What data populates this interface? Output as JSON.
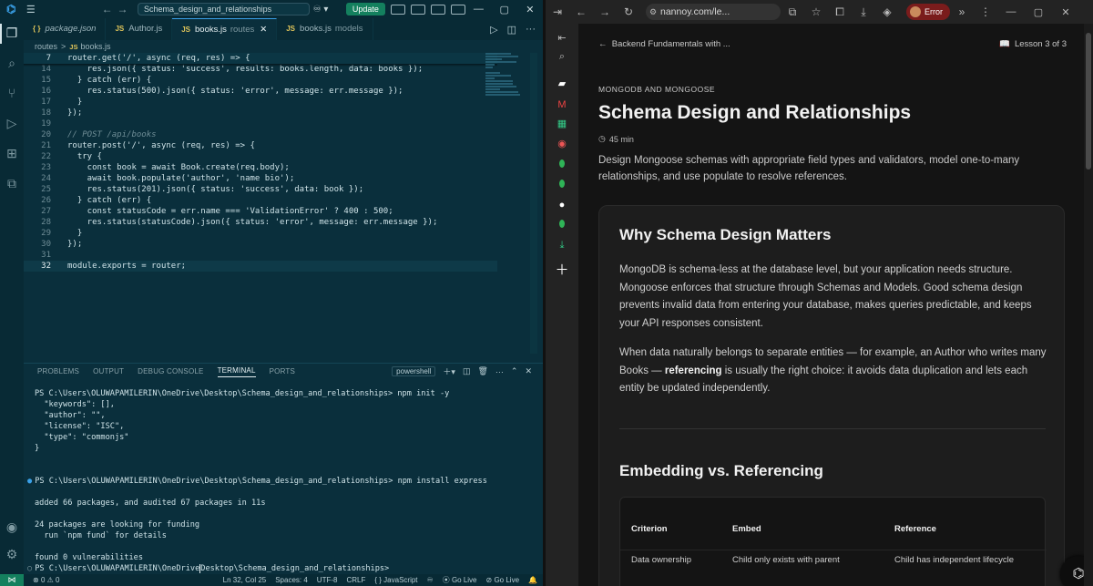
{
  "vscode": {
    "command_center": "Schema_design_and_relationships",
    "update_button": "Update",
    "tabs": [
      {
        "icon": "{ }",
        "label": "package.json",
        "sub": ""
      },
      {
        "icon": "JS",
        "label": "Author.js",
        "sub": ""
      },
      {
        "icon": "JS",
        "label": "books.js",
        "sub": "routes"
      },
      {
        "icon": "JS",
        "label": "books.js",
        "sub": "models"
      }
    ],
    "breadcrumb": {
      "folder": "routes",
      "sep": ">",
      "file_icon": "JS",
      "file": "books.js"
    },
    "code_lines": [
      {
        "num": "7",
        "text": "router.get('/', async (req, res) => {"
      },
      {
        "num": "14",
        "text": "    res.json({ status: 'success', results: books.length, data: books });"
      },
      {
        "num": "15",
        "text": "  } catch (err) {"
      },
      {
        "num": "16",
        "text": "    res.status(500).json({ status: 'error', message: err.message });"
      },
      {
        "num": "17",
        "text": "  }"
      },
      {
        "num": "18",
        "text": "});"
      },
      {
        "num": "19",
        "text": ""
      },
      {
        "num": "20",
        "text": "// POST /api/books"
      },
      {
        "num": "21",
        "text": "router.post('/', async (req, res) => {"
      },
      {
        "num": "22",
        "text": "  try {"
      },
      {
        "num": "23",
        "text": "    const book = await Book.create(req.body);"
      },
      {
        "num": "24",
        "text": "    await book.populate('author', 'name bio');"
      },
      {
        "num": "25",
        "text": "    res.status(201).json({ status: 'success', data: book });"
      },
      {
        "num": "26",
        "text": "  } catch (err) {"
      },
      {
        "num": "27",
        "text": "    const statusCode = err.name === 'ValidationError' ? 400 : 500;"
      },
      {
        "num": "28",
        "text": "    res.status(statusCode).json({ status: 'error', message: err.message });"
      },
      {
        "num": "29",
        "text": "  }"
      },
      {
        "num": "30",
        "text": "});"
      },
      {
        "num": "31",
        "text": ""
      },
      {
        "num": "32",
        "text": "module.exports = router;"
      }
    ],
    "panel_tabs": [
      "PROBLEMS",
      "OUTPUT",
      "DEBUG CONSOLE",
      "TERMINAL",
      "PORTS"
    ],
    "active_panel_tab": "TERMINAL",
    "shell": "powershell",
    "terminal": {
      "line1": "PS C:\\Users\\OLUWAPAMILERIN\\OneDrive\\Desktop\\Schema_design_and_relationships> npm init -y",
      "line2": "  \"keywords\": [],",
      "line3": "  \"author\": \"\",",
      "line4": "  \"license\": \"ISC\",",
      "line5": "  \"type\": \"commonjs\"",
      "line6": "}",
      "line7": "PS C:\\Users\\OLUWAPAMILERIN\\OneDrive\\Desktop\\Schema_design_and_relationships> npm install express",
      "line8": "added 66 packages, and audited 67 packages in 11s",
      "line9": "24 packages are looking for funding",
      "line10": "  run `npm fund` for details",
      "line11": "found 0 vulnerabilities",
      "line12a": "PS C:\\Users\\OLUWAPAMILERIN\\OneDrive",
      "line12b": "Desktop\\Schema_design_and_relationships>"
    },
    "status": {
      "errors": "0",
      "warnings": "0",
      "position": "Ln 32, Col 25",
      "spaces": "Spaces: 4",
      "encoding": "UTF-8",
      "eol": "CRLF",
      "language": "JavaScript",
      "go_live_1": "Go Live",
      "go_live_2": "Go Live"
    }
  },
  "browser": {
    "url": "nannoy.com/le...",
    "profile_status": "Error",
    "page": {
      "back_link": "Backend Fundamentals with ...",
      "lesson_counter": "Lesson 3 of 3",
      "eyebrow": "MONGODB AND MONGOOSE",
      "title": "Schema Design and Relationships",
      "duration": "45 min",
      "summary": "Design Mongoose schemas with appropriate field types and validators, model one-to-many relationships, and use populate to resolve references.",
      "section1_title": "Why Schema Design Matters",
      "section1_p1": "MongoDB is schema-less at the database level, but your application needs structure. Mongoose enforces that structure through Schemas and Models. Good schema design prevents invalid data from entering your database, makes queries predictable, and keeps your API responses consistent.",
      "section1_p2_before": "When data naturally belongs to separate entities — for example, an Author who writes many Books — ",
      "section1_p2_bold": "referencing",
      "section1_p2_after": " is usually the right choice: it avoids data duplication and lets each entity be updated independently.",
      "section2_title": "Embedding vs. Referencing",
      "table": {
        "headers": [
          "Criterion",
          "Embed",
          "Reference"
        ],
        "rows": [
          [
            "Data ownership",
            "Child only exists with parent",
            "Child has independent lifecycle"
          ]
        ]
      }
    }
  }
}
